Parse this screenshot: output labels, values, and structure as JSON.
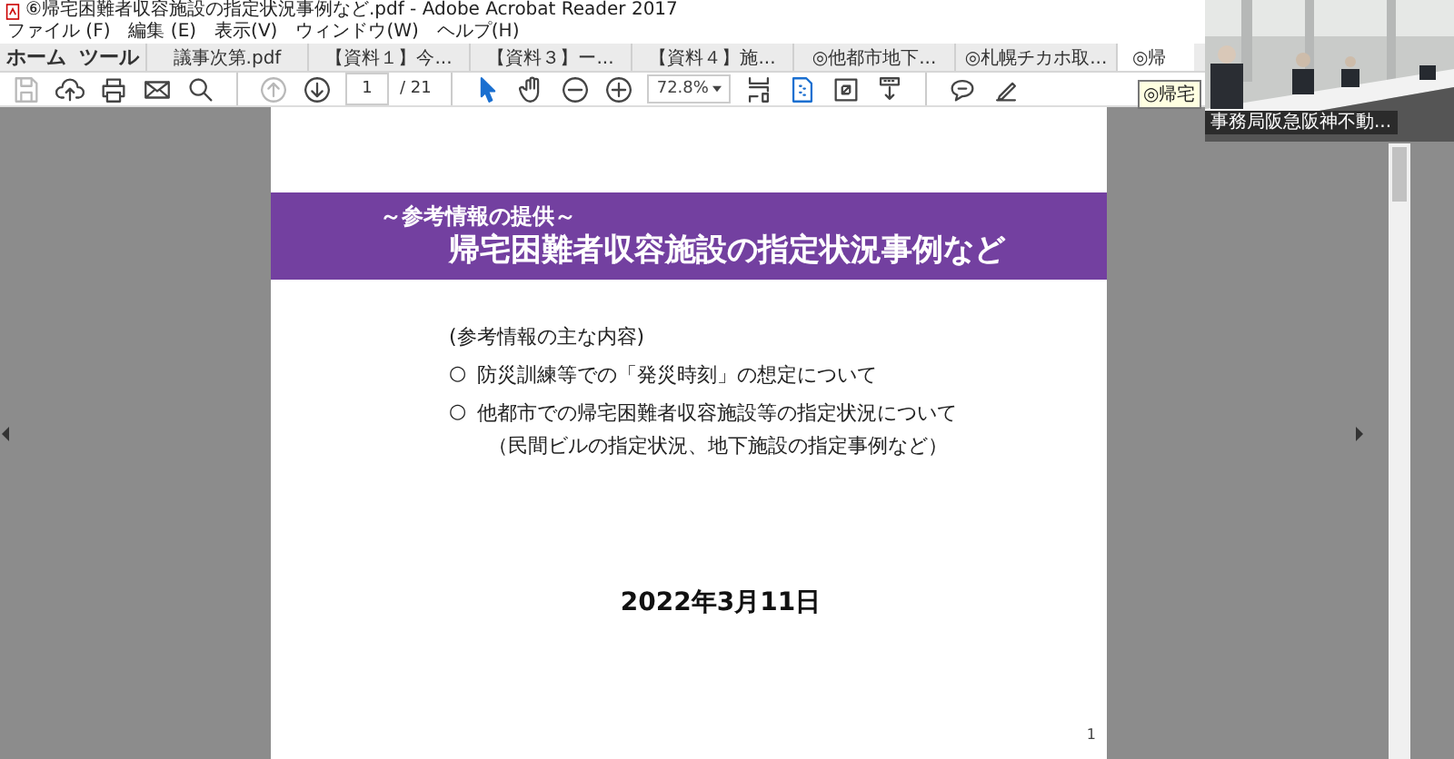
{
  "window": {
    "title": "⑥帰宅困難者収容施設の指定状況事例など.pdf - Adobe Acrobat Reader 2017"
  },
  "menu": [
    "ファイル (F)",
    "編集 (E)",
    "表示(V)",
    "ウィンドウ(W)",
    "ヘルプ(H)"
  ],
  "nav": [
    "ホーム",
    "ツール"
  ],
  "tabs": [
    {
      "label": "議事次第.pdf",
      "selected": false
    },
    {
      "label": "【資料１】今...",
      "selected": false
    },
    {
      "label": "【資料３】ー...",
      "selected": false
    },
    {
      "label": "【資料４】施...",
      "selected": false
    },
    {
      "label": "◎他都市地下...",
      "selected": false
    },
    {
      "label": "◎札幌チカホ取...",
      "selected": false
    },
    {
      "label": "◎帰",
      "selected": true
    }
  ],
  "tooltip": "◎帰宅",
  "toolbar": [
    {
      "kind": "save",
      "disabled": true
    },
    {
      "kind": "upload",
      "disabled": false
    },
    {
      "kind": "print",
      "disabled": false
    },
    {
      "kind": "mail",
      "disabled": false
    },
    {
      "kind": "search",
      "disabled": false
    },
    {
      "kind": "sep"
    },
    {
      "kind": "up",
      "disabled": true
    },
    {
      "kind": "down",
      "disabled": false
    },
    {
      "kind": "page"
    },
    {
      "kind": "sep"
    },
    {
      "kind": "pointer",
      "selected": true
    },
    {
      "kind": "hand",
      "selected": false
    },
    {
      "kind": "zoomout",
      "disabled": false
    },
    {
      "kind": "zoomin",
      "disabled": false
    },
    {
      "kind": "zoom"
    },
    {
      "kind": "fit",
      "disabled": false
    },
    {
      "kind": "spread",
      "selected": true
    },
    {
      "kind": "fullscreen",
      "disabled": false
    },
    {
      "kind": "scroll",
      "disabled": false
    },
    {
      "kind": "sep"
    },
    {
      "kind": "comment",
      "disabled": false
    },
    {
      "kind": "sign",
      "disabled": false
    }
  ],
  "page_field": {
    "value": "1",
    "total": "/ 21"
  },
  "zoom_field": {
    "value": "72.8%"
  },
  "document": {
    "subtitle": "～参考情報の提供～",
    "title": "帰宅困難者収容施設の指定状況事例など",
    "lead": "(参考情報の主な内容)",
    "bullets": [
      {
        "mark": "○",
        "lines": [
          "防災訓練等での「発災時刻」の想定について"
        ]
      },
      {
        "mark": "○",
        "lines": [
          "他都市での帰宅困難者収容施設等の指定状況について",
          "（民間ビルの指定状況、地下施設の指定事例など）"
        ]
      }
    ],
    "date": "2022年3月11日",
    "page_number": "1"
  },
  "video": {
    "caption": "事務局阪急阪神不動..."
  }
}
